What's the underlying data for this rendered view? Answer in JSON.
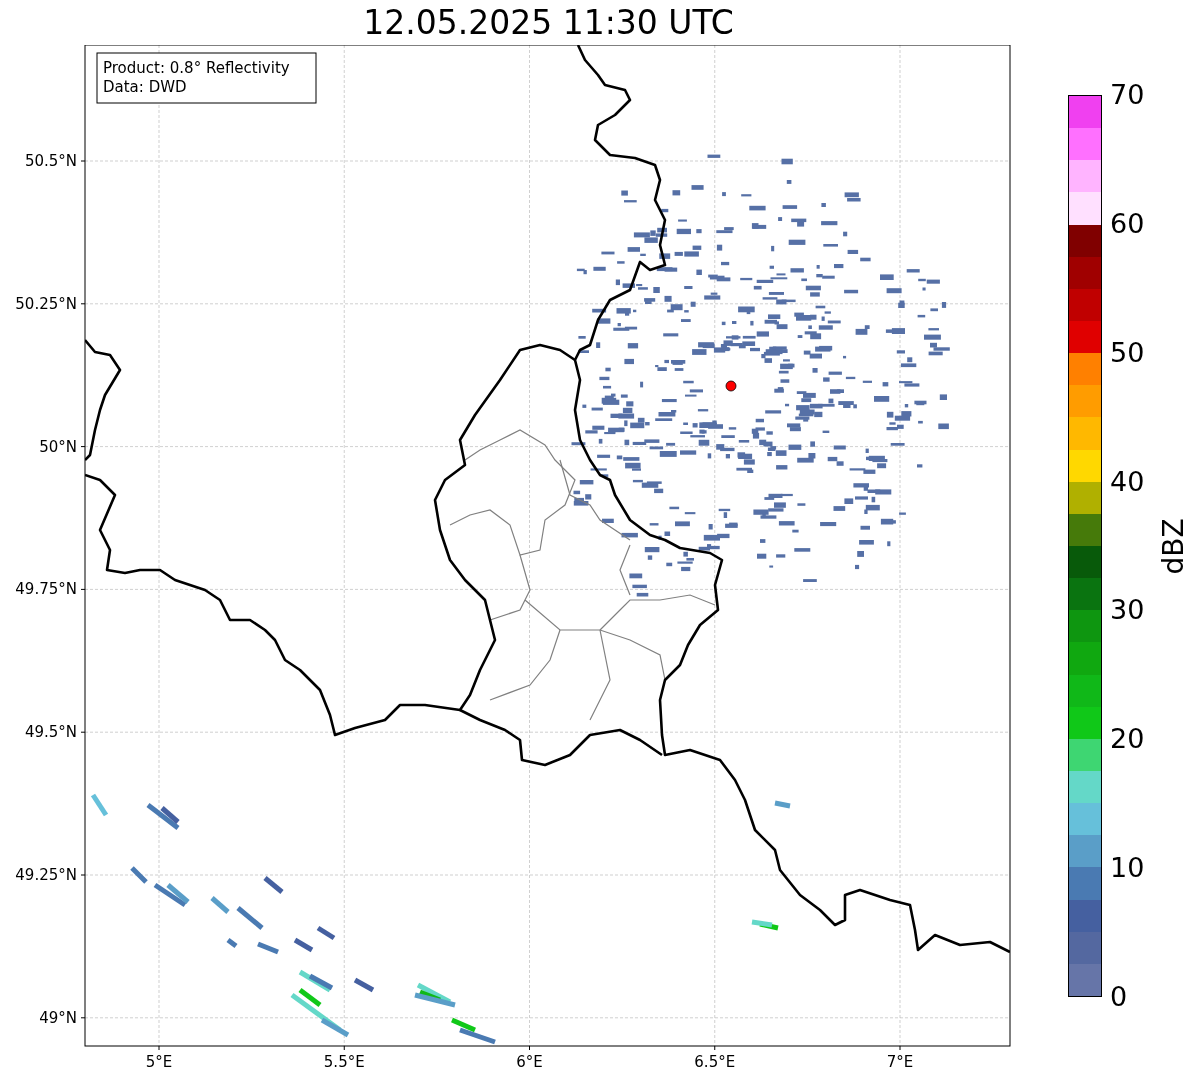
{
  "title": "12.05.2025 11:30 UTC",
  "info_box": {
    "lines": [
      "Product: 0.8° Reflectivity",
      "Data: DWD"
    ]
  },
  "map": {
    "y_ticks": [
      "50.5°N",
      "50.25°N",
      "50°N",
      "49.75°N",
      "49.5°N",
      "49.25°N",
      "49°N"
    ],
    "x_ticks": [
      "5°E",
      "5.5°E",
      "6°E",
      "6.5°E",
      "7°E"
    ]
  },
  "colorbar": {
    "label": "dBZ",
    "ticks": [
      "70",
      "60",
      "50",
      "40",
      "30",
      "20",
      "10",
      "0"
    ],
    "segments": [
      {
        "color": "#f040f0"
      },
      {
        "color": "#ff70ff"
      },
      {
        "color": "#ffb4ff"
      },
      {
        "color": "#ffe0ff"
      },
      {
        "color": "#800000"
      },
      {
        "color": "#a00000"
      },
      {
        "color": "#c00000"
      },
      {
        "color": "#e00000"
      },
      {
        "color": "#ff8000"
      },
      {
        "color": "#ff9c00"
      },
      {
        "color": "#ffb800"
      },
      {
        "color": "#ffd800"
      },
      {
        "color": "#b0b000"
      },
      {
        "color": "#467a0a"
      },
      {
        "color": "#085a0a"
      },
      {
        "color": "#0a7410"
      },
      {
        "color": "#0e9610"
      },
      {
        "color": "#10a810"
      },
      {
        "color": "#10b818"
      },
      {
        "color": "#10c818"
      },
      {
        "color": "#3ed672"
      },
      {
        "color": "#64d8c8"
      },
      {
        "color": "#66c0da"
      },
      {
        "color": "#5a9ec8"
      },
      {
        "color": "#4a7ab2"
      },
      {
        "color": "#4560a0"
      },
      {
        "color": "#5468a0"
      },
      {
        "color": "#6675a8"
      }
    ]
  }
}
